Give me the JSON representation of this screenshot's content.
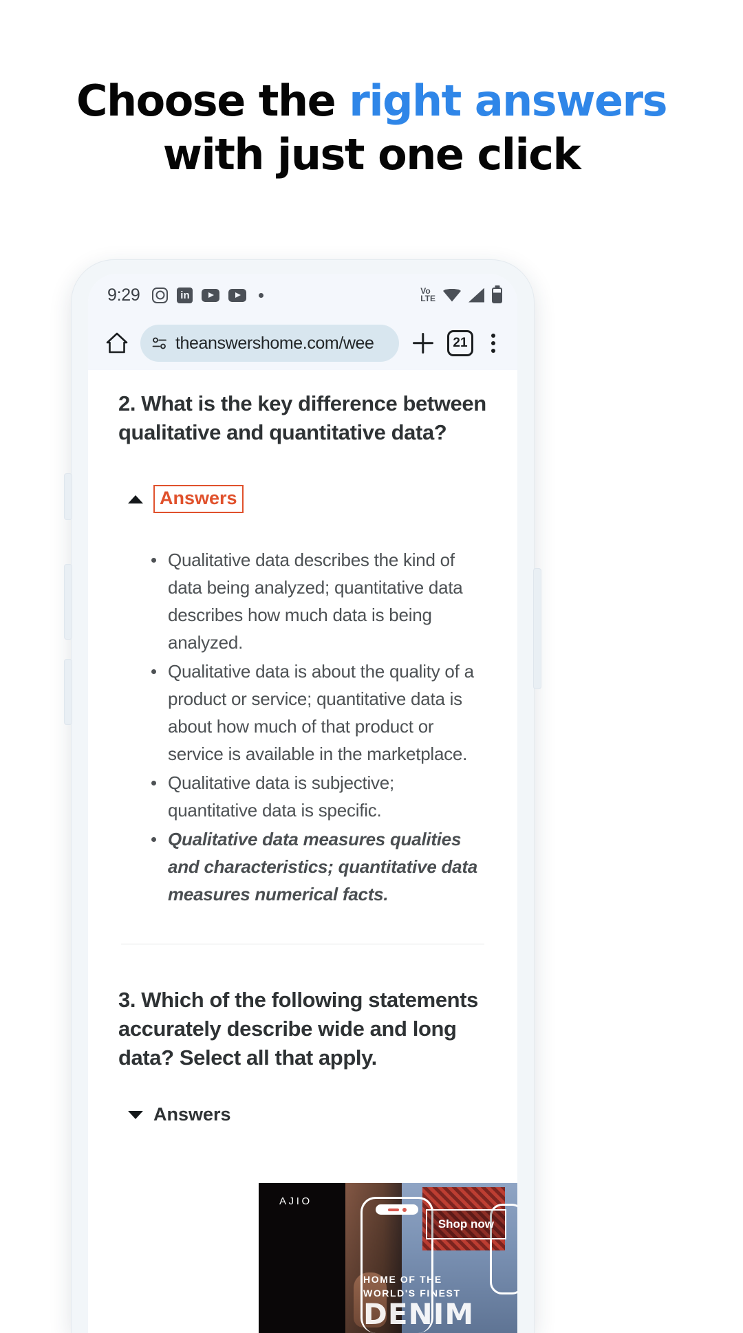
{
  "promo": {
    "line1_part1": "Choose the ",
    "line1_highlight": "right answers",
    "line2": "with just one click",
    "highlight_color": "#2f86e8"
  },
  "statusbar": {
    "time": "9:29",
    "left_icons": [
      "instagram-icon",
      "linkedin-icon",
      "youtube-icon",
      "youtube-icon",
      "dot-icon"
    ],
    "linkedin_text": "in",
    "network": "Vo LTE",
    "network_line1": "Vo",
    "network_line2": "LTE",
    "right_icons": [
      "volte-icon",
      "wifi-icon",
      "signal-icon",
      "battery-icon"
    ]
  },
  "toolbar": {
    "home_icon": "home-icon",
    "permission_icon": "site-permissions-icon",
    "url": "theanswershome.com/wee",
    "new_tab_icon": "plus-icon",
    "tab_count": "21",
    "menu_icon": "overflow-menu-icon"
  },
  "page": {
    "question2": {
      "title": "2. What is the key difference between qualitative and quantitative data?",
      "toggle_label": "Answers",
      "toggle_state": "expanded",
      "toggle_color": "#e0512c",
      "answers": [
        {
          "text": "Qualitative data describes the kind of data being analyzed; quantitative data describes how much data is being analyzed.",
          "correct": false
        },
        {
          "text": "Qualitative data is about the quality of a product or service; quantitative data is about how much of that product or service is available in the marketplace.",
          "correct": false
        },
        {
          "text": "Qualitative data is subjective; quantitative data is specific.",
          "correct": false
        },
        {
          "text": "Qualitative data measures qualities and characteristics; quantitative data measures numerical facts.",
          "correct": true
        }
      ]
    },
    "question3": {
      "title": "3. Which of the following statements accurately describe wide and long data? Select all that apply.",
      "toggle_label": "Answers",
      "toggle_state": "collapsed"
    }
  },
  "ad": {
    "brand": "AJIO",
    "headline_line1": "HOME OF THE",
    "headline_line2": "WORLD'S FINEST",
    "headline_line3": "DENIM",
    "cta": "Shop now",
    "close_icon": "close-icon",
    "close_glyph": "×"
  }
}
